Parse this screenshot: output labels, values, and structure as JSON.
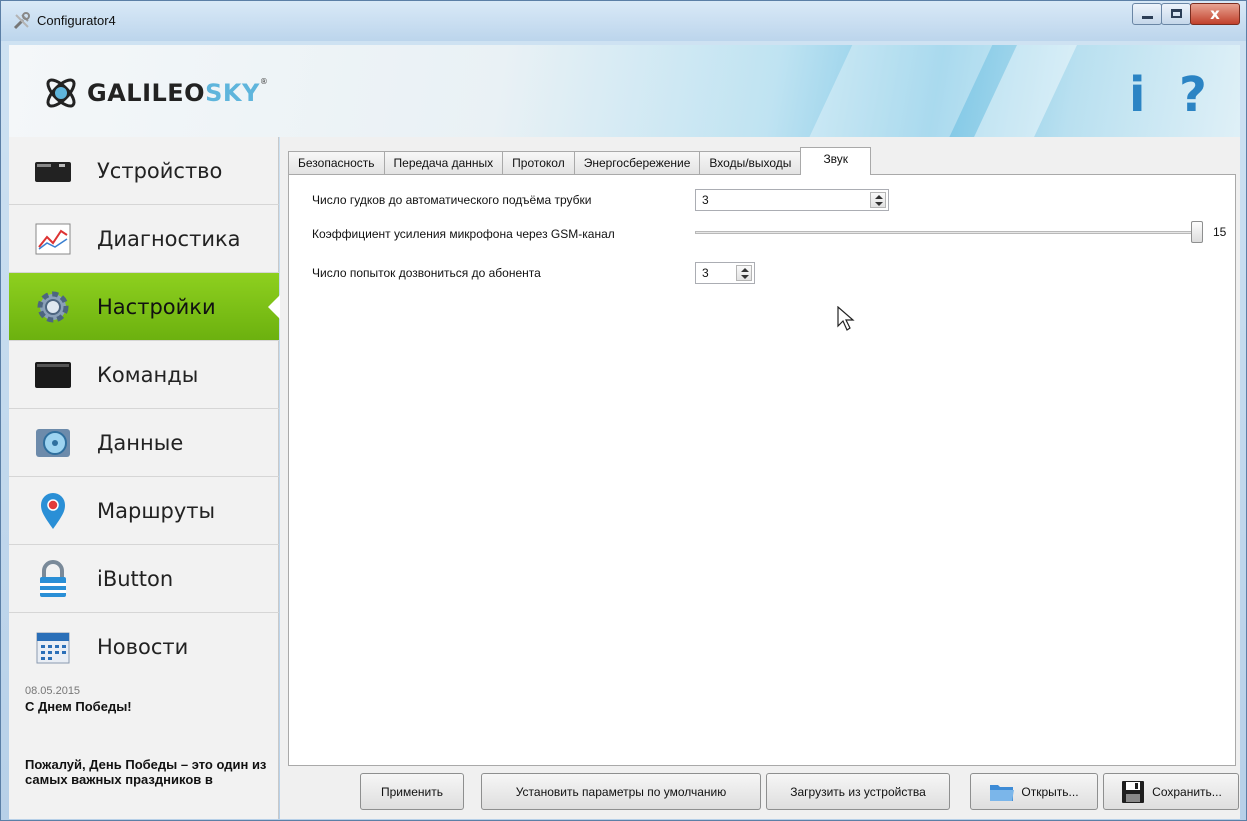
{
  "window": {
    "title": "Configurator4",
    "controls": {
      "close_glyph": "x"
    }
  },
  "header": {
    "logo_text_a": "GALILEO",
    "logo_text_b": "SKY",
    "logo_reg": "®",
    "info_glyph": "i",
    "help_glyph": "?"
  },
  "sidebar": {
    "items": [
      {
        "label": "Устройство",
        "icon": "device-icon"
      },
      {
        "label": "Диагностика",
        "icon": "diagnostics-chart-icon"
      },
      {
        "label": "Настройки",
        "icon": "gear-icon",
        "active": true
      },
      {
        "label": "Команды",
        "icon": "terminal-icon"
      },
      {
        "label": "Данные",
        "icon": "data-disk-icon"
      },
      {
        "label": "Маршруты",
        "icon": "map-pin-icon"
      },
      {
        "label": "iButton",
        "icon": "lock-icon"
      },
      {
        "label": "Новости",
        "icon": "calendar-icon"
      }
    ],
    "news": {
      "date": "08.05.2015",
      "title": "С Днем Победы!",
      "body": "Пожалуй, День Победы – это один из самых важных праздников в"
    }
  },
  "tabs": [
    {
      "label": "Безопасность"
    },
    {
      "label": "Передача данных"
    },
    {
      "label": "Протокол"
    },
    {
      "label": "Энергосбережение"
    },
    {
      "label": "Входы/выходы"
    },
    {
      "label": "Звук",
      "active": true
    }
  ],
  "sound": {
    "rings_label": "Число гудков до автоматического подъёма трубки",
    "rings_value": "3",
    "gain_label": "Коэффициент усиления микрофона через GSM-канал",
    "gain_value": "15",
    "gain_max": 15,
    "gain_level": 15,
    "attempts_label": "Число попыток дозвониться до абонента",
    "attempts_value": "3"
  },
  "buttons": {
    "apply": "Применить",
    "defaults": "Установить параметры по умолчанию",
    "load": "Загрузить из устройства",
    "open": "Открыть...",
    "save": "Сохранить..."
  },
  "colors": {
    "active_nav": "#7cc11a",
    "brand_blue": "#2b84c4"
  }
}
